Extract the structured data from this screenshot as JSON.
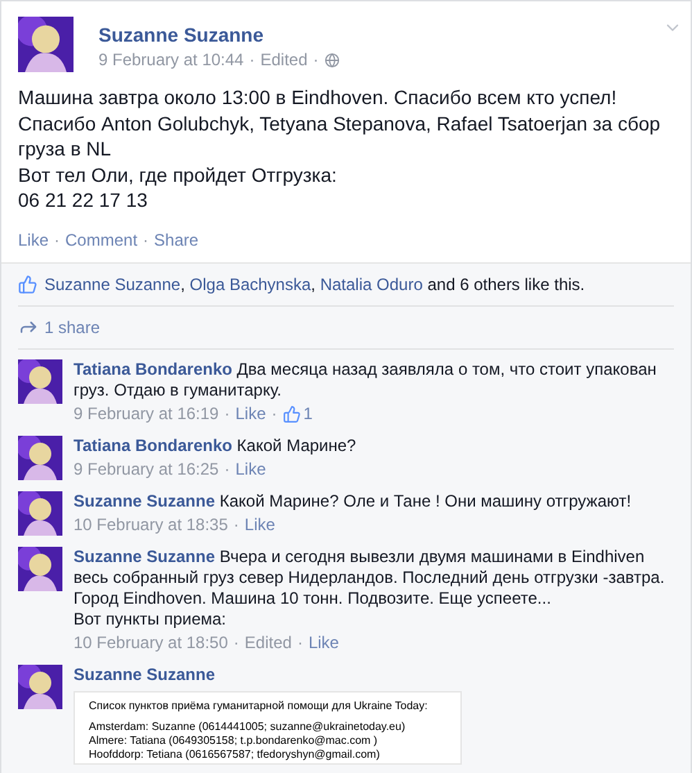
{
  "separator": "·",
  "post": {
    "author": "Suzanne Suzanne",
    "timestamp": "9 February at 10:44",
    "edited": "Edited",
    "body": [
      "Машина завтра около 13:00 в Eindhoven. Спасибо всем кто успел!",
      "Спасибо Anton Golubchyk, Tetyana Stepanova, Rafael Tsatoerjan за сбор груза в NL",
      "Вот тел Оли, где пройдет Отгрузка:",
      "06 21 22 17 13"
    ],
    "actions": [
      "Like",
      "Comment",
      "Share"
    ]
  },
  "likes": {
    "likers": [
      "Suzanne Suzanne",
      "Olga Bachynska",
      "Natalia Oduro"
    ],
    "list_separator": ",",
    "rest": "and 6 others like this."
  },
  "shares": "1 share",
  "comments": [
    {
      "author": "Tatiana Bondarenko",
      "text": "Два месяца назад заявляла о том, что стоит упакован груз. Отдаю в гуманитарку.",
      "timestamp": "9 February at 16:19",
      "like": "Like",
      "like_count": "1"
    },
    {
      "author": "Tatiana Bondarenko",
      "text": "Какой Марине?",
      "timestamp": "9 February at 16:25",
      "like": "Like"
    },
    {
      "author": "Suzanne Suzanne",
      "text": "Какой Марине? Оле и Тане ! Они машину отгружают!",
      "timestamp": "10 February at 18:35",
      "like": "Like"
    },
    {
      "author": "Suzanne Suzanne",
      "text": "Вчера и сегодня вывезли двумя машинами в Eindhiven весь собранный груз север Нидерландов. Последний день отгрузки -завтра. Город Eindhoven. Машина 10 тонн. Подвозите. Еще успеете...",
      "text2": "Вот пункты приема:",
      "timestamp": "10 February at 18:50",
      "edited": "Edited",
      "like": "Like"
    },
    {
      "author": "Suzanne Suzanne",
      "attachment": {
        "kind": "document",
        "title": "Список пунктов приёма гуманитарной помощи для Ukraine Today:",
        "lines": [
          "Amsterdam: Suzanne (0614441005; suzanne@ukrainetoday.eu)",
          "Almere: Tatiana (0649305158; t.p.bondarenko@mac.com )",
          "Hoofddorp: Tetiana (0616567587; tfedoryshyn@gmail.com)"
        ]
      }
    }
  ]
}
